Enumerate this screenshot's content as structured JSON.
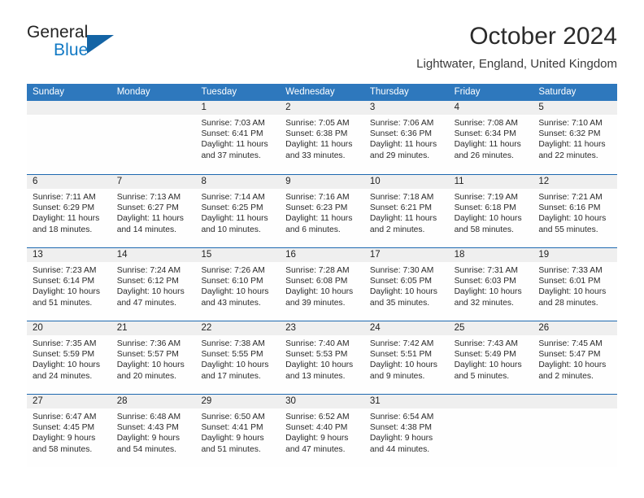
{
  "brand": {
    "line1": "General",
    "line2": "Blue",
    "triangle_color": "#1464a5",
    "blue_text_color": "#1179c4"
  },
  "header": {
    "title": "October 2024",
    "subtitle": "Lightwater, England, United Kingdom"
  },
  "theme": {
    "header_row_bg": "#2e78bd",
    "header_row_text": "#ffffff",
    "week_divider": "#1e69b0",
    "day_number_band_bg": "#efefef",
    "cell_bg": "#fefefe",
    "body_text": "#2a2a2a"
  },
  "weekday_headers": [
    "Sunday",
    "Monday",
    "Tuesday",
    "Wednesday",
    "Thursday",
    "Friday",
    "Saturday"
  ],
  "weeks": [
    [
      {
        "day": "",
        "lines": []
      },
      {
        "day": "",
        "lines": []
      },
      {
        "day": "1",
        "lines": [
          "Sunrise: 7:03 AM",
          "Sunset: 6:41 PM",
          "Daylight: 11 hours",
          "and 37 minutes."
        ]
      },
      {
        "day": "2",
        "lines": [
          "Sunrise: 7:05 AM",
          "Sunset: 6:38 PM",
          "Daylight: 11 hours",
          "and 33 minutes."
        ]
      },
      {
        "day": "3",
        "lines": [
          "Sunrise: 7:06 AM",
          "Sunset: 6:36 PM",
          "Daylight: 11 hours",
          "and 29 minutes."
        ]
      },
      {
        "day": "4",
        "lines": [
          "Sunrise: 7:08 AM",
          "Sunset: 6:34 PM",
          "Daylight: 11 hours",
          "and 26 minutes."
        ]
      },
      {
        "day": "5",
        "lines": [
          "Sunrise: 7:10 AM",
          "Sunset: 6:32 PM",
          "Daylight: 11 hours",
          "and 22 minutes."
        ]
      }
    ],
    [
      {
        "day": "6",
        "lines": [
          "Sunrise: 7:11 AM",
          "Sunset: 6:29 PM",
          "Daylight: 11 hours",
          "and 18 minutes."
        ]
      },
      {
        "day": "7",
        "lines": [
          "Sunrise: 7:13 AM",
          "Sunset: 6:27 PM",
          "Daylight: 11 hours",
          "and 14 minutes."
        ]
      },
      {
        "day": "8",
        "lines": [
          "Sunrise: 7:14 AM",
          "Sunset: 6:25 PM",
          "Daylight: 11 hours",
          "and 10 minutes."
        ]
      },
      {
        "day": "9",
        "lines": [
          "Sunrise: 7:16 AM",
          "Sunset: 6:23 PM",
          "Daylight: 11 hours",
          "and 6 minutes."
        ]
      },
      {
        "day": "10",
        "lines": [
          "Sunrise: 7:18 AM",
          "Sunset: 6:21 PM",
          "Daylight: 11 hours",
          "and 2 minutes."
        ]
      },
      {
        "day": "11",
        "lines": [
          "Sunrise: 7:19 AM",
          "Sunset: 6:18 PM",
          "Daylight: 10 hours",
          "and 58 minutes."
        ]
      },
      {
        "day": "12",
        "lines": [
          "Sunrise: 7:21 AM",
          "Sunset: 6:16 PM",
          "Daylight: 10 hours",
          "and 55 minutes."
        ]
      }
    ],
    [
      {
        "day": "13",
        "lines": [
          "Sunrise: 7:23 AM",
          "Sunset: 6:14 PM",
          "Daylight: 10 hours",
          "and 51 minutes."
        ]
      },
      {
        "day": "14",
        "lines": [
          "Sunrise: 7:24 AM",
          "Sunset: 6:12 PM",
          "Daylight: 10 hours",
          "and 47 minutes."
        ]
      },
      {
        "day": "15",
        "lines": [
          "Sunrise: 7:26 AM",
          "Sunset: 6:10 PM",
          "Daylight: 10 hours",
          "and 43 minutes."
        ]
      },
      {
        "day": "16",
        "lines": [
          "Sunrise: 7:28 AM",
          "Sunset: 6:08 PM",
          "Daylight: 10 hours",
          "and 39 minutes."
        ]
      },
      {
        "day": "17",
        "lines": [
          "Sunrise: 7:30 AM",
          "Sunset: 6:05 PM",
          "Daylight: 10 hours",
          "and 35 minutes."
        ]
      },
      {
        "day": "18",
        "lines": [
          "Sunrise: 7:31 AM",
          "Sunset: 6:03 PM",
          "Daylight: 10 hours",
          "and 32 minutes."
        ]
      },
      {
        "day": "19",
        "lines": [
          "Sunrise: 7:33 AM",
          "Sunset: 6:01 PM",
          "Daylight: 10 hours",
          "and 28 minutes."
        ]
      }
    ],
    [
      {
        "day": "20",
        "lines": [
          "Sunrise: 7:35 AM",
          "Sunset: 5:59 PM",
          "Daylight: 10 hours",
          "and 24 minutes."
        ]
      },
      {
        "day": "21",
        "lines": [
          "Sunrise: 7:36 AM",
          "Sunset: 5:57 PM",
          "Daylight: 10 hours",
          "and 20 minutes."
        ]
      },
      {
        "day": "22",
        "lines": [
          "Sunrise: 7:38 AM",
          "Sunset: 5:55 PM",
          "Daylight: 10 hours",
          "and 17 minutes."
        ]
      },
      {
        "day": "23",
        "lines": [
          "Sunrise: 7:40 AM",
          "Sunset: 5:53 PM",
          "Daylight: 10 hours",
          "and 13 minutes."
        ]
      },
      {
        "day": "24",
        "lines": [
          "Sunrise: 7:42 AM",
          "Sunset: 5:51 PM",
          "Daylight: 10 hours",
          "and 9 minutes."
        ]
      },
      {
        "day": "25",
        "lines": [
          "Sunrise: 7:43 AM",
          "Sunset: 5:49 PM",
          "Daylight: 10 hours",
          "and 5 minutes."
        ]
      },
      {
        "day": "26",
        "lines": [
          "Sunrise: 7:45 AM",
          "Sunset: 5:47 PM",
          "Daylight: 10 hours",
          "and 2 minutes."
        ]
      }
    ],
    [
      {
        "day": "27",
        "lines": [
          "Sunrise: 6:47 AM",
          "Sunset: 4:45 PM",
          "Daylight: 9 hours",
          "and 58 minutes."
        ]
      },
      {
        "day": "28",
        "lines": [
          "Sunrise: 6:48 AM",
          "Sunset: 4:43 PM",
          "Daylight: 9 hours",
          "and 54 minutes."
        ]
      },
      {
        "day": "29",
        "lines": [
          "Sunrise: 6:50 AM",
          "Sunset: 4:41 PM",
          "Daylight: 9 hours",
          "and 51 minutes."
        ]
      },
      {
        "day": "30",
        "lines": [
          "Sunrise: 6:52 AM",
          "Sunset: 4:40 PM",
          "Daylight: 9 hours",
          "and 47 minutes."
        ]
      },
      {
        "day": "31",
        "lines": [
          "Sunrise: 6:54 AM",
          "Sunset: 4:38 PM",
          "Daylight: 9 hours",
          "and 44 minutes."
        ]
      },
      {
        "day": "",
        "lines": []
      },
      {
        "day": "",
        "lines": []
      }
    ]
  ]
}
